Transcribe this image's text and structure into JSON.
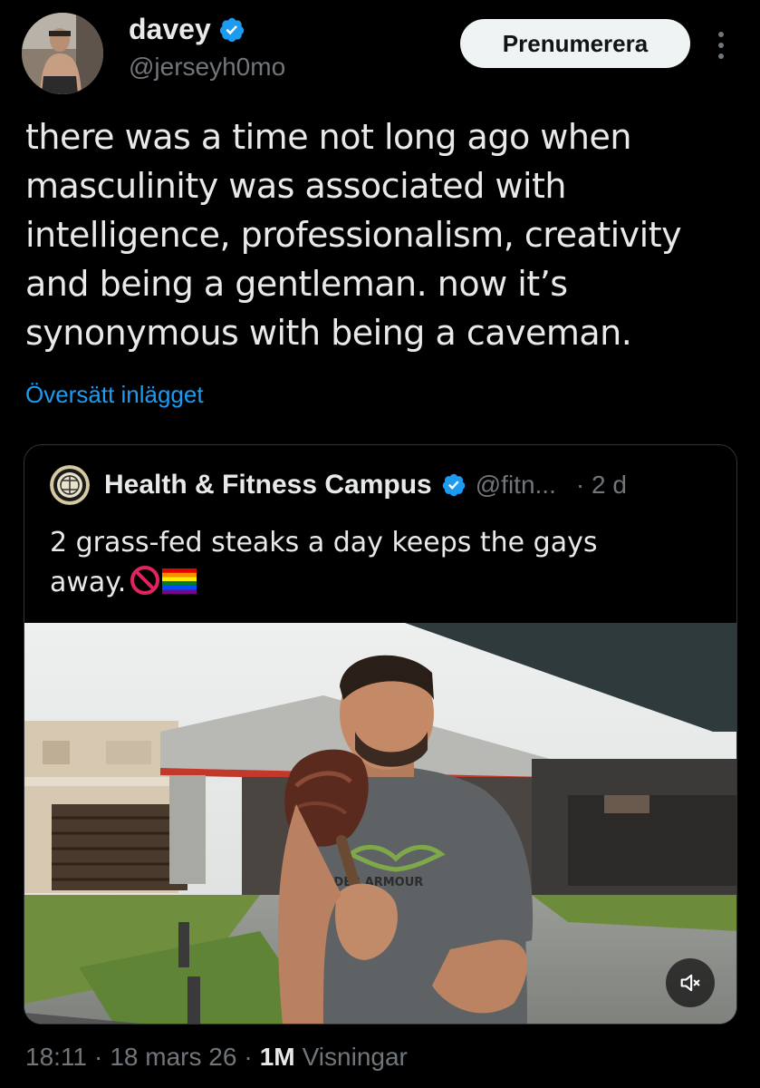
{
  "author": {
    "display_name": "davey",
    "handle": "@jerseyh0mo",
    "verified": true
  },
  "subscribe_label": "Prenumerera",
  "tweet": {
    "lines": [
      "there was a time not long ago when",
      "masculinity was associated with",
      "intelligence, professionalism, creativity",
      "and being a gentleman. now it’s",
      "synonymous with being a caveman."
    ],
    "translate_label": "Översätt inlägget"
  },
  "quote": {
    "display_name": "Health & Fitness Campus",
    "handle": "@fitn...",
    "time": "· 2 d",
    "text_line1": "2 grass-fed steaks a day keeps the gays",
    "text_line2": "away.",
    "verified": true,
    "media": {
      "shirt_text": "UNDER ARMOUR",
      "mute_icon": "speaker-muted-icon"
    }
  },
  "meta": {
    "time": "18:11",
    "sep1": "·",
    "date": "18 mars 26",
    "sep2": "·",
    "views_count": "1M",
    "views_label": "Visningar"
  },
  "colors": {
    "background": "#000000",
    "text": "#e7e9ea",
    "secondary": "#71767b",
    "link": "#1d9bf0",
    "verified": "#1d9bf0",
    "border": "#2f3336"
  }
}
